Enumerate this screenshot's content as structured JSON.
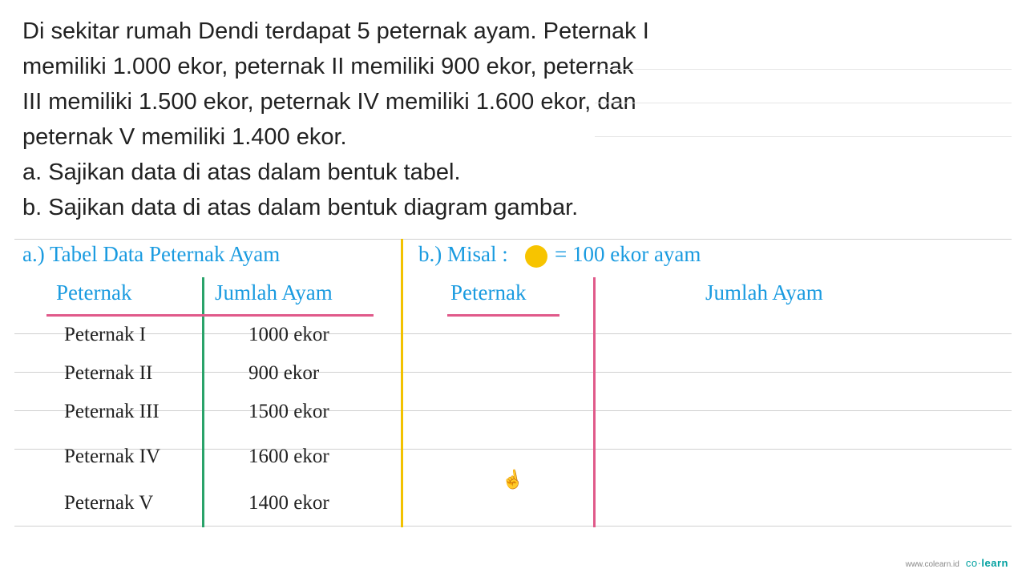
{
  "problem": {
    "l1": "Di sekitar rumah Dendi terdapat 5 peternak ayam. Peternak I",
    "l2": "memiliki 1.000 ekor, peternak II memiliki 900 ekor, peternak",
    "l3": "III memiliki 1.500 ekor, peternak IV memiliki 1.600 ekor, dan",
    "l4": "peternak V memiliki 1.400 ekor.",
    "a": "a.  Sajikan data di atas dalam bentuk tabel.",
    "b": "b.  Sajikan data di atas dalam bentuk diagram gambar."
  },
  "section_a": {
    "label": "a.)",
    "title": "Tabel  Data  Peternak  Ayam",
    "col1": "Peternak",
    "col2": "Jumlah  Ayam",
    "rows": [
      {
        "name": "Peternak I",
        "value": "1000 ekor"
      },
      {
        "name": "Peternak II",
        "value": "900 ekor"
      },
      {
        "name": "Peternak III",
        "value": "1500 ekor"
      },
      {
        "name": "Peternak IV",
        "value": "1600 ekor"
      },
      {
        "name": "Peternak V",
        "value": "1400 ekor"
      }
    ]
  },
  "section_b": {
    "label": "b.)",
    "misal": "Misal :",
    "eq": "= 100 ekor ayam",
    "col1": "Peternak",
    "col2": "Jumlah  Ayam",
    "dot_color": "#f7c400",
    "dot_meaning": "100 ekor ayam"
  },
  "cursor": "☝",
  "footer": {
    "url": "www.colearn.id",
    "brand_light": "co·",
    "brand_bold": "learn"
  },
  "chart_data": {
    "type": "table",
    "title": "Tabel Data Peternak Ayam",
    "columns": [
      "Peternak",
      "Jumlah Ayam (ekor)"
    ],
    "rows": [
      [
        "Peternak I",
        1000
      ],
      [
        "Peternak II",
        900
      ],
      [
        "Peternak III",
        1500
      ],
      [
        "Peternak IV",
        1600
      ],
      [
        "Peternak V",
        1400
      ]
    ],
    "pictograph_key": {
      "symbol": "●",
      "value": 100,
      "unit": "ekor ayam"
    }
  }
}
